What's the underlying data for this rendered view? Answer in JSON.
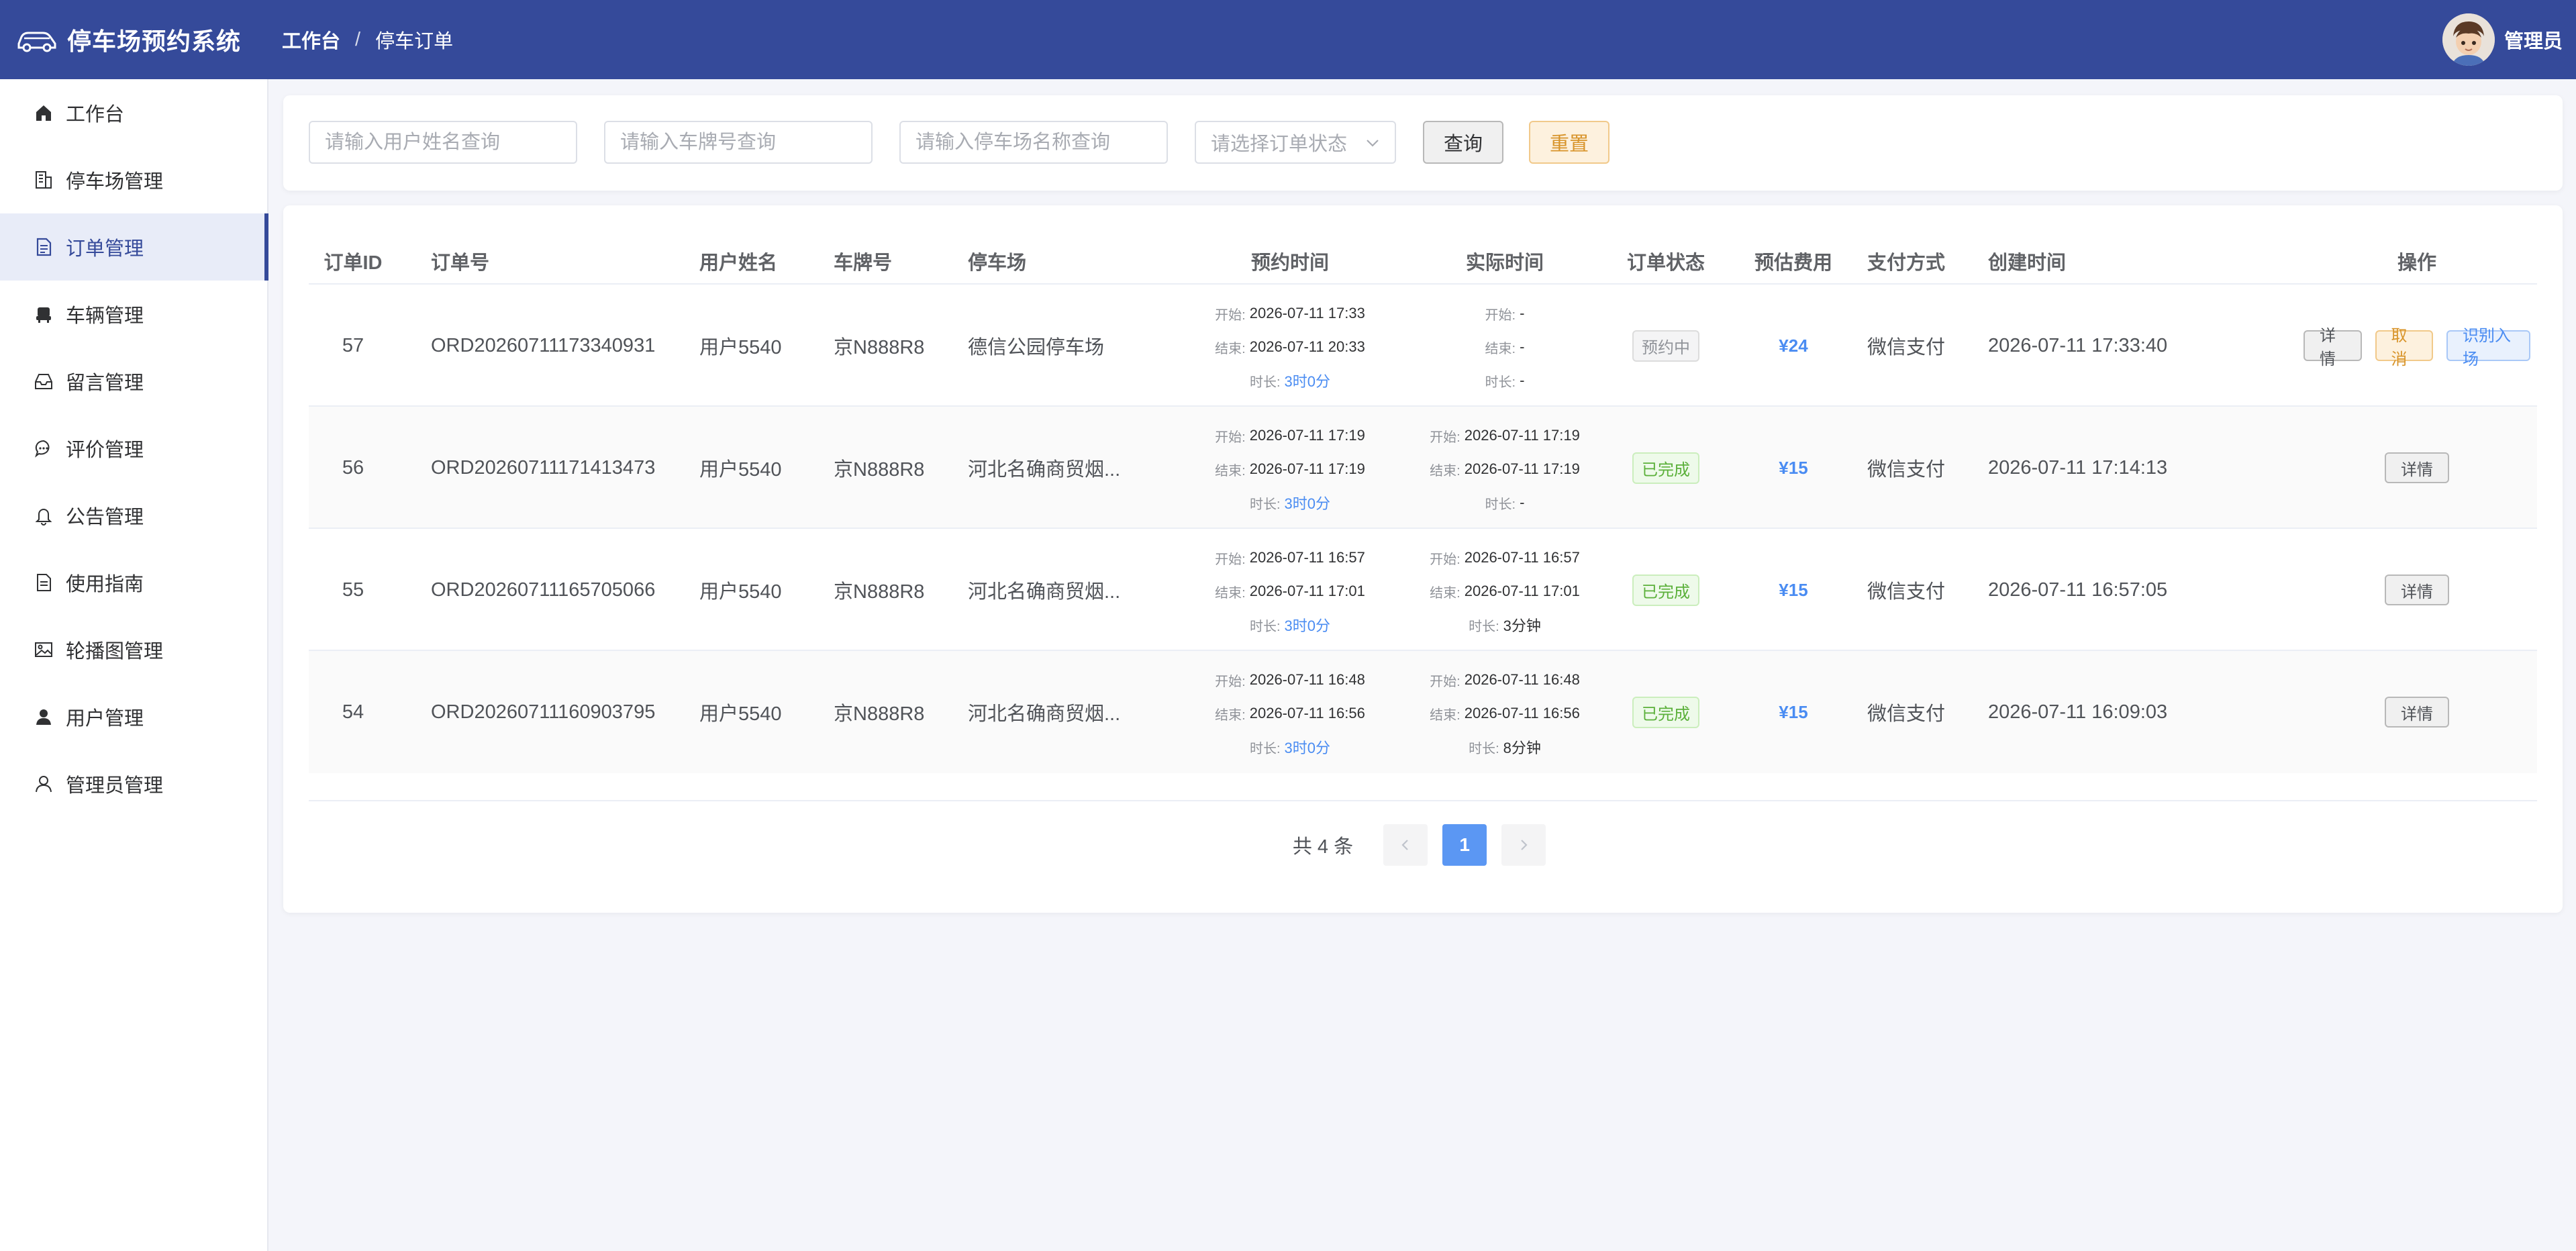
{
  "app": {
    "title": "停车场预约系统"
  },
  "breadcrumb": {
    "home": "工作台",
    "separator": "/",
    "current": "停车订单"
  },
  "user": {
    "name": "管理员"
  },
  "sidebar": {
    "items": [
      {
        "label": "工作台",
        "icon": "home-icon"
      },
      {
        "label": "停车场管理",
        "icon": "building-icon"
      },
      {
        "label": "订单管理",
        "icon": "document-icon",
        "active": true
      },
      {
        "label": "车辆管理",
        "icon": "car-seat-icon"
      },
      {
        "label": "留言管理",
        "icon": "inbox-icon"
      },
      {
        "label": "评价管理",
        "icon": "chat-icon"
      },
      {
        "label": "公告管理",
        "icon": "bell-icon"
      },
      {
        "label": "使用指南",
        "icon": "guide-document-icon"
      },
      {
        "label": "轮播图管理",
        "icon": "picture-icon"
      },
      {
        "label": "用户管理",
        "icon": "user-filled-icon"
      },
      {
        "label": "管理员管理",
        "icon": "user-outline-icon"
      }
    ]
  },
  "search": {
    "username_placeholder": "请输入用户姓名查询",
    "plate_placeholder": "请输入车牌号查询",
    "lot_placeholder": "请输入停车场名称查询",
    "status_placeholder": "请选择订单状态",
    "query_label": "查询",
    "reset_label": "重置"
  },
  "table": {
    "headers": [
      "订单ID",
      "订单号",
      "用户姓名",
      "车牌号",
      "停车场",
      "预约时间",
      "实际时间",
      "订单状态",
      "预估费用",
      "支付方式",
      "创建时间",
      "操作"
    ],
    "start_label": "开始:",
    "end_label": "结束:",
    "duration_label": "时长:",
    "rows": [
      {
        "id": "57",
        "order_no": "ORD20260711173340931",
        "username": "用户5540",
        "plate": "京N888R8",
        "lot": "德信公园停车场",
        "res_start": "2026-07-11 17:33",
        "res_end": "2026-07-11 20:33",
        "res_duration": "3时0分",
        "act_start": "-",
        "act_end": "-",
        "act_duration": "-",
        "status": "预约中",
        "fee": "¥24",
        "payment": "微信支付",
        "created": "2026-07-11 17:33:40",
        "actions": {
          "detail": "详情",
          "cancel": "取消",
          "enter": "识别入场"
        }
      },
      {
        "id": "56",
        "order_no": "ORD20260711171413473",
        "username": "用户5540",
        "plate": "京N888R8",
        "lot": "河北名确商贸烟...",
        "res_start": "2026-07-11 17:19",
        "res_end": "2026-07-11 17:19",
        "res_duration": "3时0分",
        "act_start": "2026-07-11 17:19",
        "act_end": "2026-07-11 17:19",
        "act_duration": "-",
        "status": "已完成",
        "fee": "¥15",
        "payment": "微信支付",
        "created": "2026-07-11 17:14:13",
        "actions": {
          "detail": "详情"
        }
      },
      {
        "id": "55",
        "order_no": "ORD20260711165705066",
        "username": "用户5540",
        "plate": "京N888R8",
        "lot": "河北名确商贸烟...",
        "res_start": "2026-07-11 16:57",
        "res_end": "2026-07-11 17:01",
        "res_duration": "3时0分",
        "act_start": "2026-07-11 16:57",
        "act_end": "2026-07-11 17:01",
        "act_duration": "3分钟",
        "status": "已完成",
        "fee": "¥15",
        "payment": "微信支付",
        "created": "2026-07-11 16:57:05",
        "actions": {
          "detail": "详情"
        }
      },
      {
        "id": "54",
        "order_no": "ORD20260711160903795",
        "username": "用户5540",
        "plate": "京N888R8",
        "lot": "河北名确商贸烟...",
        "res_start": "2026-07-11 16:48",
        "res_end": "2026-07-11 16:56",
        "res_duration": "3时0分",
        "act_start": "2026-07-11 16:48",
        "act_end": "2026-07-11 16:56",
        "act_duration": "8分钟",
        "status": "已完成",
        "fee": "¥15",
        "payment": "微信支付",
        "created": "2026-07-11 16:09:03",
        "actions": {
          "detail": "详情"
        }
      }
    ]
  },
  "pagination": {
    "total_label": "共 4 条",
    "current_page": "1",
    "prev_icon": "chevron-left-icon",
    "next_icon": "chevron-right-icon"
  },
  "colors": {
    "header_bg": "#354a9a",
    "accent": "#4a8cf2",
    "success": "#5bb03a",
    "warning": "#d8942a"
  }
}
